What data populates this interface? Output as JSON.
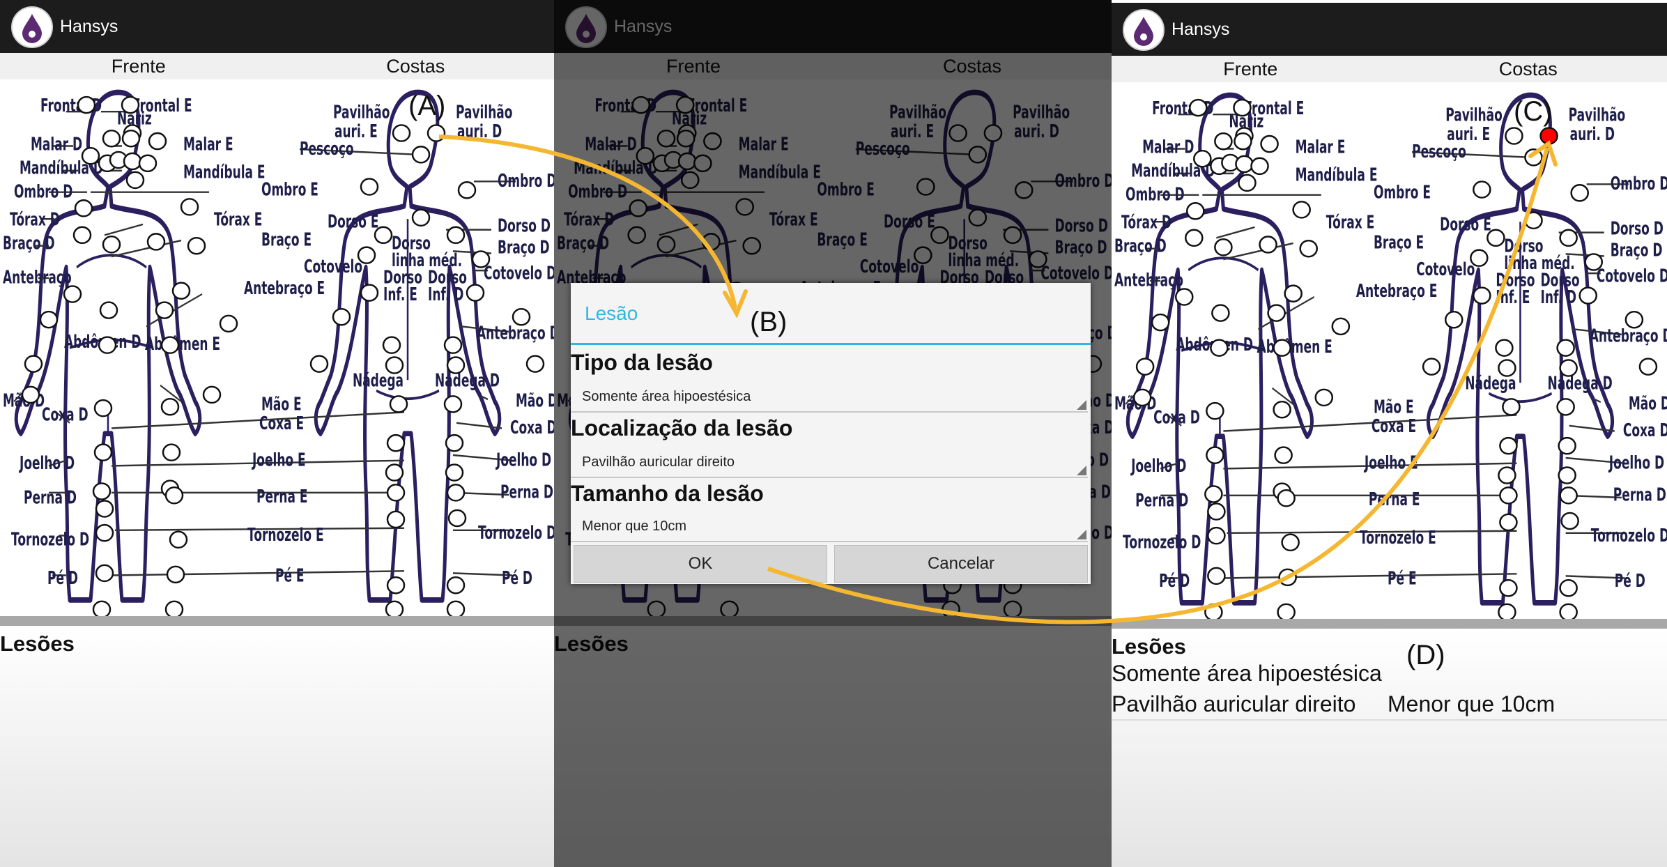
{
  "app": {
    "title": "Hansys"
  },
  "tabs": {
    "front": "Frente",
    "back": "Costas"
  },
  "front_labels": [
    "Frontal D",
    "Frontal E",
    "Nariz",
    "Malar D",
    "Malar E",
    "Mandíbula D",
    "Mandíbula E",
    "Ombro D",
    "Ombro E",
    "Tórax D",
    "Tórax E",
    "Braço D",
    "Braço E",
    "Antebraço",
    "Antebraço E",
    "Abdômen D",
    "Abdômen E",
    "Mão D",
    "Mão E",
    "Coxa D",
    "Coxa E",
    "Joelho D",
    "Joelho E",
    "Perna D",
    "Perna E",
    "Tornozelo D",
    "Tornozelo E",
    "Pé D",
    "Pé E"
  ],
  "back_labels": [
    "Pavilhão",
    "auri. E",
    "Pavilhão",
    "auri. D",
    "Pescoço",
    "Ombro D",
    "Dorso E",
    "Dorso D",
    "Dorso",
    "linha méd.",
    "Braço D",
    "Cotovelo",
    "Cotovelo D",
    "Dorso",
    "Inf. E",
    "Dorso",
    "Inf. D",
    "Antebraço D",
    "Nádega",
    "Nádega D",
    "Mão D",
    "Coxa D",
    "Joelho D",
    "Perna D",
    "Tornozelo D",
    "Pé D"
  ],
  "lesoes": {
    "title": "Lesões"
  },
  "dialog": {
    "title": "Lesão",
    "tipo_label": "Tipo da lesão",
    "tipo_value": "Somente área hipoestésica",
    "local_label": "Localização da lesão",
    "local_value": "Pavilhão auricular direito",
    "tamanho_label": "Tamanho da lesão",
    "tamanho_value": "Menor que 10cm",
    "ok": "OK",
    "cancel": "Cancelar"
  },
  "result": {
    "line1": "Somente área hipoestésica",
    "line2_location": "Pavilhão auricular direito",
    "line2_size": "Menor que 10cm"
  },
  "markers": {
    "a": "(A)",
    "b": "(B)",
    "c": "(C)",
    "d": "(D)"
  },
  "colors": {
    "accent": "#33b5e5",
    "arrow": "#f5b731",
    "selected_point": "#ff0000",
    "outline": "#2b1f5f"
  }
}
